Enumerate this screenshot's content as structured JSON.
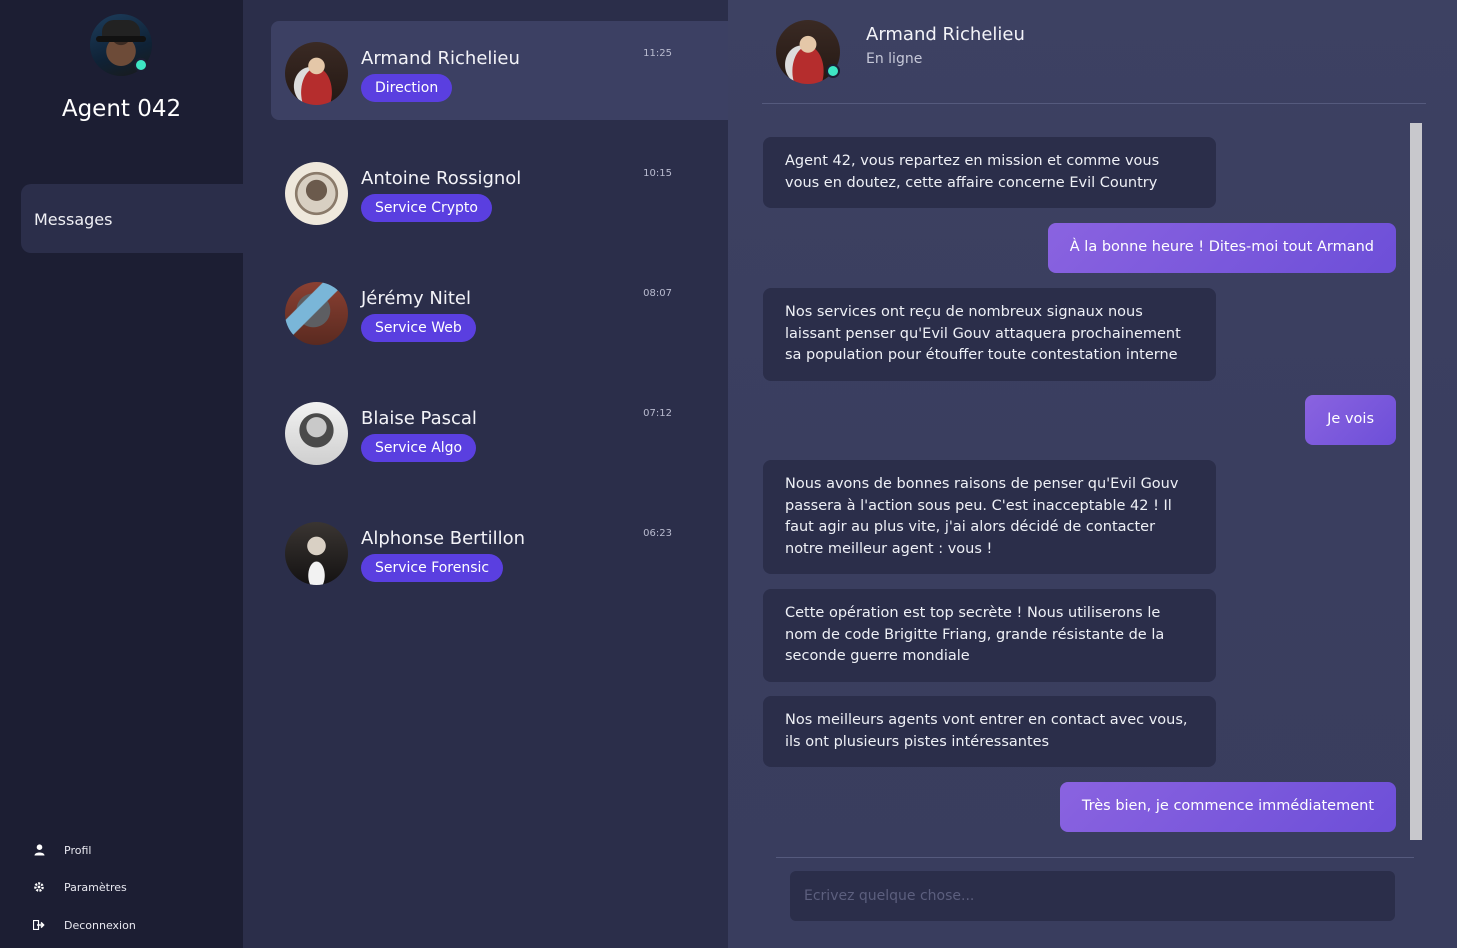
{
  "user": {
    "name": "Agent 042",
    "status_color": "#3ee6c4",
    "avatar_icon": "agent-avatar"
  },
  "nav": {
    "messages_label": "Messages"
  },
  "bottom_menu": [
    {
      "label": "Profil",
      "icon": "user-icon"
    },
    {
      "label": "Paramètres",
      "icon": "gear-icon"
    },
    {
      "label": "Deconnexion",
      "icon": "logout-icon"
    }
  ],
  "contacts": [
    {
      "name": "Armand Richelieu",
      "badge": "Direction",
      "time": "11:25",
      "active": true
    },
    {
      "name": "Antoine Rossignol",
      "badge": "Service Crypto",
      "time": "10:15",
      "active": false
    },
    {
      "name": "Jérémy Nitel",
      "badge": "Service Web",
      "time": "08:07",
      "active": false
    },
    {
      "name": "Blaise Pascal",
      "badge": "Service Algo",
      "time": "07:12",
      "active": false
    },
    {
      "name": "Alphonse Bertillon",
      "badge": "Service Forensic",
      "time": "06:23",
      "active": false
    }
  ],
  "chat": {
    "name": "Armand Richelieu",
    "status": "En ligne",
    "messages": [
      {
        "dir": "in",
        "text": "Agent 42, vous repartez en mission et comme vous vous en doutez, cette affaire concerne Evil Country"
      },
      {
        "dir": "out",
        "text": "À la bonne heure ! Dites-moi tout Armand"
      },
      {
        "dir": "in",
        "text": "Nos services ont reçu de nombreux signaux nous laissant penser qu'Evil Gouv attaquera prochainement sa population pour étouffer toute contestation interne"
      },
      {
        "dir": "out",
        "text": "Je vois"
      },
      {
        "dir": "in",
        "text": "Nous avons de bonnes raisons de penser qu'Evil Gouv passera à l'action sous peu. C'est inacceptable 42 ! Il faut agir au plus vite, j'ai alors décidé de contacter notre meilleur agent : vous !"
      },
      {
        "dir": "in",
        "text": "Cette opération est top secrète ! Nous utiliserons le nom de code Brigitte Friang, grande résistante de la seconde guerre mondiale"
      },
      {
        "dir": "in",
        "text": "Nos meilleurs agents vont entrer en contact avec vous, ils ont plusieurs pistes intéressantes"
      },
      {
        "dir": "out",
        "text": "Très bien, je commence immédiatement"
      }
    ],
    "composer_placeholder": "Ecrivez quelque chose..."
  },
  "colors": {
    "sidebar": "#1c1e33",
    "panel": "#2b2e4a",
    "active": "#3c4063",
    "badge": "#5a3fe0",
    "online": "#3ee6c4"
  }
}
